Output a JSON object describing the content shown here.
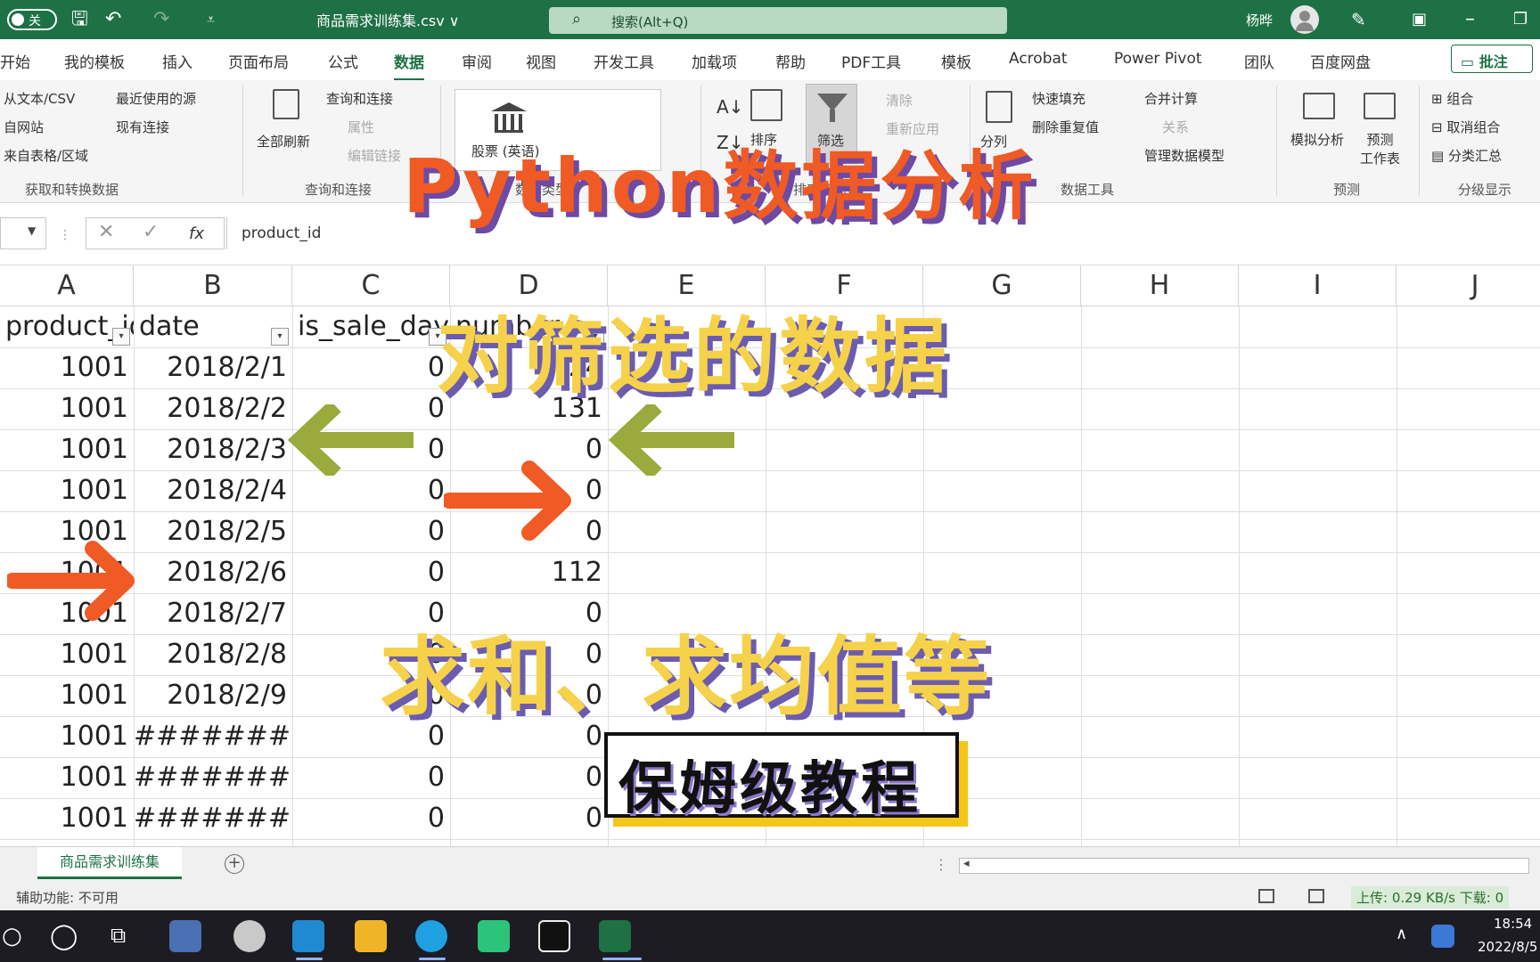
{
  "titlebar": {
    "autosave_label": "关",
    "filename": "商品需求训练集.csv ∨",
    "search_placeholder": "搜索(Alt+Q)",
    "user_name": "杨晔"
  },
  "menu": {
    "tabs": [
      "开始",
      "我的模板",
      "插入",
      "页面布局",
      "公式",
      "数据",
      "审阅",
      "视图",
      "开发工具",
      "加载项",
      "帮助",
      "PDF工具",
      "模板",
      "Acrobat",
      "Power Pivot",
      "团队",
      "百度网盘"
    ],
    "active_tab": "数据",
    "comment_label": "批注"
  },
  "ribbon": {
    "get_data": {
      "items": [
        "从文本/CSV",
        "自网站",
        "来自表格/区域",
        "最近使用的源",
        "现有连接"
      ],
      "group_label": "获取和转换数据"
    },
    "queries": {
      "refresh_label": "全部刷新",
      "items": [
        "查询和连接",
        "属性",
        "编辑链接"
      ],
      "group_label": "查询和连接"
    },
    "data_types": {
      "stock_label": "股票 (英语)",
      "group_label": "数据类型"
    },
    "sort_filter": {
      "sort_label": "排序",
      "filter_label": "筛选",
      "clear_label": "清除",
      "reapply_label": "重新应用",
      "group_label": "排序和筛选"
    },
    "data_tools": {
      "items": [
        "快速填充",
        "删除重复值",
        "合并计算",
        "关系",
        "管理数据模型"
      ],
      "split_label": "分列",
      "group_label": "数据工具"
    },
    "forecast": {
      "whatif_label": "模拟分析",
      "sheet_label": "预测\n工作表",
      "group_label": "预测"
    },
    "outline": {
      "items": [
        "组合",
        "取消组合",
        "分类汇总"
      ],
      "group_label": "分级显示"
    }
  },
  "formula_bar": {
    "content": "product_id",
    "fx_label": "fx"
  },
  "sheet": {
    "columns": [
      "A",
      "B",
      "C",
      "D",
      "E",
      "F",
      "G",
      "H",
      "I",
      "J"
    ],
    "headers": [
      "product_id",
      "date",
      "is_sale_day",
      "number"
    ],
    "rows": [
      [
        "1001",
        "2018/2/1",
        "0",
        "24"
      ],
      [
        "1001",
        "2018/2/2",
        "0",
        "131"
      ],
      [
        "1001",
        "2018/2/3",
        "0",
        "0"
      ],
      [
        "1001",
        "2018/2/4",
        "0",
        "0"
      ],
      [
        "1001",
        "2018/2/5",
        "0",
        "0"
      ],
      [
        "1001",
        "2018/2/6",
        "0",
        "112"
      ],
      [
        "1001",
        "2018/2/7",
        "0",
        "0"
      ],
      [
        "1001",
        "2018/2/8",
        "0",
        "0"
      ],
      [
        "1001",
        "2018/2/9",
        "0",
        "0"
      ],
      [
        "1001",
        "#######",
        "0",
        "0"
      ],
      [
        "1001",
        "#######",
        "0",
        "0"
      ],
      [
        "1001",
        "#######",
        "0",
        "0"
      ]
    ]
  },
  "sheet_tabs": {
    "active": "商品需求训练集"
  },
  "status": {
    "accessibility": "辅助功能: 不可用",
    "network": "上传: 0.29 KB/s  下载: 0"
  },
  "taskbar": {
    "time": "18:54",
    "date": "2022/8/5"
  },
  "overlay": {
    "title": "Python数据分析",
    "subtitle1": "对筛选的数据",
    "subtitle2": "求和、求均值等",
    "tag": "保姆级教程"
  },
  "colors": {
    "excel_green": "#1e7145",
    "overlay_orange": "#f05a24",
    "overlay_yellow": "#f6d24a",
    "overlay_purple": "#6b5cb0",
    "arrow_green": "#9aaa3c",
    "arrow_orange": "#f05a24"
  }
}
